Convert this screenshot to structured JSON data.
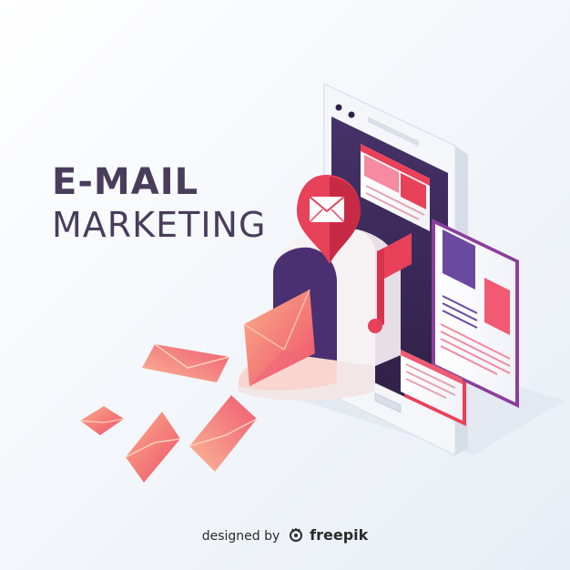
{
  "headline": {
    "line1": "E-MAIL",
    "line2": "MARKETING"
  },
  "credit": {
    "prefix": "designed by",
    "brand": "freepik",
    "logo_icon": "freepik-logo-icon"
  },
  "colors": {
    "text": "#4a3d5c",
    "accent_red": "#e8415a",
    "accent_pink": "#f36b7f",
    "accent_peach": "#f9a98a",
    "phone_screen": "#3d2a5c",
    "phone_body": "#f4f6fa"
  }
}
